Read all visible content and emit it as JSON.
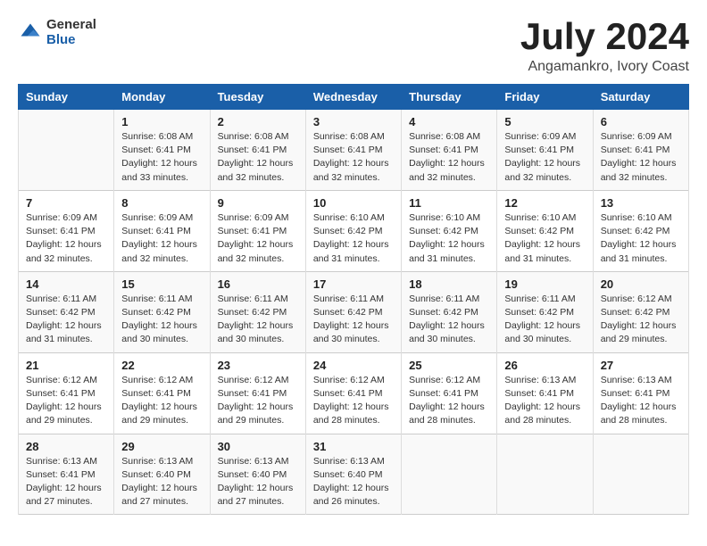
{
  "logo": {
    "general": "General",
    "blue": "Blue"
  },
  "title": "July 2024",
  "location": "Angamankro, Ivory Coast",
  "days_header": [
    "Sunday",
    "Monday",
    "Tuesday",
    "Wednesday",
    "Thursday",
    "Friday",
    "Saturday"
  ],
  "weeks": [
    [
      {
        "day": "",
        "info": ""
      },
      {
        "day": "1",
        "info": "Sunrise: 6:08 AM\nSunset: 6:41 PM\nDaylight: 12 hours\nand 33 minutes."
      },
      {
        "day": "2",
        "info": "Sunrise: 6:08 AM\nSunset: 6:41 PM\nDaylight: 12 hours\nand 32 minutes."
      },
      {
        "day": "3",
        "info": "Sunrise: 6:08 AM\nSunset: 6:41 PM\nDaylight: 12 hours\nand 32 minutes."
      },
      {
        "day": "4",
        "info": "Sunrise: 6:08 AM\nSunset: 6:41 PM\nDaylight: 12 hours\nand 32 minutes."
      },
      {
        "day": "5",
        "info": "Sunrise: 6:09 AM\nSunset: 6:41 PM\nDaylight: 12 hours\nand 32 minutes."
      },
      {
        "day": "6",
        "info": "Sunrise: 6:09 AM\nSunset: 6:41 PM\nDaylight: 12 hours\nand 32 minutes."
      }
    ],
    [
      {
        "day": "7",
        "info": "Sunrise: 6:09 AM\nSunset: 6:41 PM\nDaylight: 12 hours\nand 32 minutes."
      },
      {
        "day": "8",
        "info": "Sunrise: 6:09 AM\nSunset: 6:41 PM\nDaylight: 12 hours\nand 32 minutes."
      },
      {
        "day": "9",
        "info": "Sunrise: 6:09 AM\nSunset: 6:41 PM\nDaylight: 12 hours\nand 32 minutes."
      },
      {
        "day": "10",
        "info": "Sunrise: 6:10 AM\nSunset: 6:42 PM\nDaylight: 12 hours\nand 31 minutes."
      },
      {
        "day": "11",
        "info": "Sunrise: 6:10 AM\nSunset: 6:42 PM\nDaylight: 12 hours\nand 31 minutes."
      },
      {
        "day": "12",
        "info": "Sunrise: 6:10 AM\nSunset: 6:42 PM\nDaylight: 12 hours\nand 31 minutes."
      },
      {
        "day": "13",
        "info": "Sunrise: 6:10 AM\nSunset: 6:42 PM\nDaylight: 12 hours\nand 31 minutes."
      }
    ],
    [
      {
        "day": "14",
        "info": "Sunrise: 6:11 AM\nSunset: 6:42 PM\nDaylight: 12 hours\nand 31 minutes."
      },
      {
        "day": "15",
        "info": "Sunrise: 6:11 AM\nSunset: 6:42 PM\nDaylight: 12 hours\nand 30 minutes."
      },
      {
        "day": "16",
        "info": "Sunrise: 6:11 AM\nSunset: 6:42 PM\nDaylight: 12 hours\nand 30 minutes."
      },
      {
        "day": "17",
        "info": "Sunrise: 6:11 AM\nSunset: 6:42 PM\nDaylight: 12 hours\nand 30 minutes."
      },
      {
        "day": "18",
        "info": "Sunrise: 6:11 AM\nSunset: 6:42 PM\nDaylight: 12 hours\nand 30 minutes."
      },
      {
        "day": "19",
        "info": "Sunrise: 6:11 AM\nSunset: 6:42 PM\nDaylight: 12 hours\nand 30 minutes."
      },
      {
        "day": "20",
        "info": "Sunrise: 6:12 AM\nSunset: 6:42 PM\nDaylight: 12 hours\nand 29 minutes."
      }
    ],
    [
      {
        "day": "21",
        "info": "Sunrise: 6:12 AM\nSunset: 6:41 PM\nDaylight: 12 hours\nand 29 minutes."
      },
      {
        "day": "22",
        "info": "Sunrise: 6:12 AM\nSunset: 6:41 PM\nDaylight: 12 hours\nand 29 minutes."
      },
      {
        "day": "23",
        "info": "Sunrise: 6:12 AM\nSunset: 6:41 PM\nDaylight: 12 hours\nand 29 minutes."
      },
      {
        "day": "24",
        "info": "Sunrise: 6:12 AM\nSunset: 6:41 PM\nDaylight: 12 hours\nand 28 minutes."
      },
      {
        "day": "25",
        "info": "Sunrise: 6:12 AM\nSunset: 6:41 PM\nDaylight: 12 hours\nand 28 minutes."
      },
      {
        "day": "26",
        "info": "Sunrise: 6:13 AM\nSunset: 6:41 PM\nDaylight: 12 hours\nand 28 minutes."
      },
      {
        "day": "27",
        "info": "Sunrise: 6:13 AM\nSunset: 6:41 PM\nDaylight: 12 hours\nand 28 minutes."
      }
    ],
    [
      {
        "day": "28",
        "info": "Sunrise: 6:13 AM\nSunset: 6:41 PM\nDaylight: 12 hours\nand 27 minutes."
      },
      {
        "day": "29",
        "info": "Sunrise: 6:13 AM\nSunset: 6:40 PM\nDaylight: 12 hours\nand 27 minutes."
      },
      {
        "day": "30",
        "info": "Sunrise: 6:13 AM\nSunset: 6:40 PM\nDaylight: 12 hours\nand 27 minutes."
      },
      {
        "day": "31",
        "info": "Sunrise: 6:13 AM\nSunset: 6:40 PM\nDaylight: 12 hours\nand 26 minutes."
      },
      {
        "day": "",
        "info": ""
      },
      {
        "day": "",
        "info": ""
      },
      {
        "day": "",
        "info": ""
      }
    ]
  ]
}
